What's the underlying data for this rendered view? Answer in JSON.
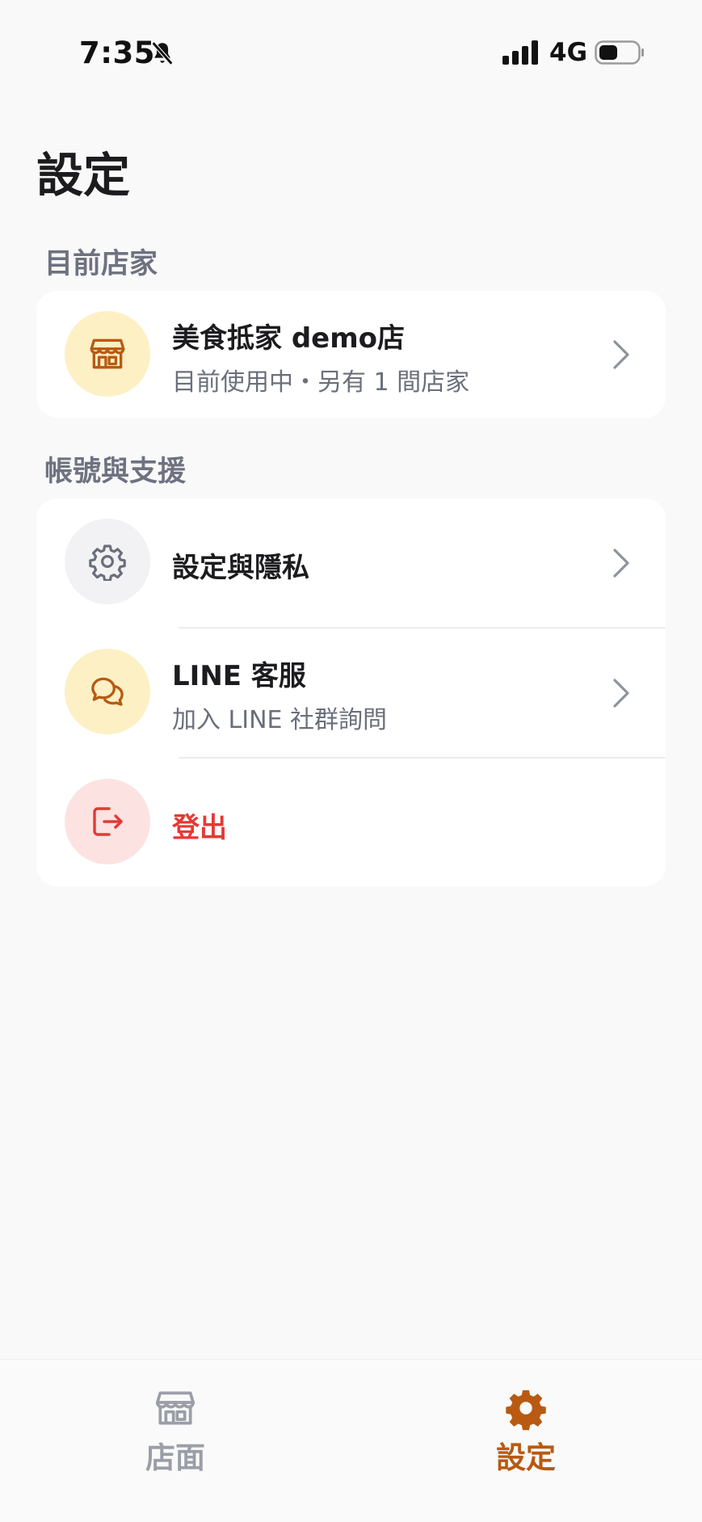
{
  "status_bar": {
    "time": "7:35",
    "network": "4G"
  },
  "page_title": "設定",
  "current_store_section": {
    "label": "目前店家",
    "store": {
      "name": "美食抵家 demo店",
      "subtitle": "目前使用中・另有 1 間店家"
    }
  },
  "account_section": {
    "label": "帳號與支援",
    "items": [
      {
        "title": "設定與隱私"
      },
      {
        "title": "LINE 客服",
        "subtitle": "加入 LINE 社群詢問"
      },
      {
        "title": "登出"
      }
    ]
  },
  "tab_bar": {
    "tabs": [
      {
        "label": "店面",
        "active": false
      },
      {
        "label": "設定",
        "active": true
      }
    ]
  },
  "colors": {
    "accent": "#b85a12",
    "accent_bg": "#fdf0c5",
    "logout": "#e53935",
    "logout_bg": "#fde2e2",
    "neutral_bg": "#f2f2f4",
    "inactive_tab": "#9a9ea8"
  }
}
